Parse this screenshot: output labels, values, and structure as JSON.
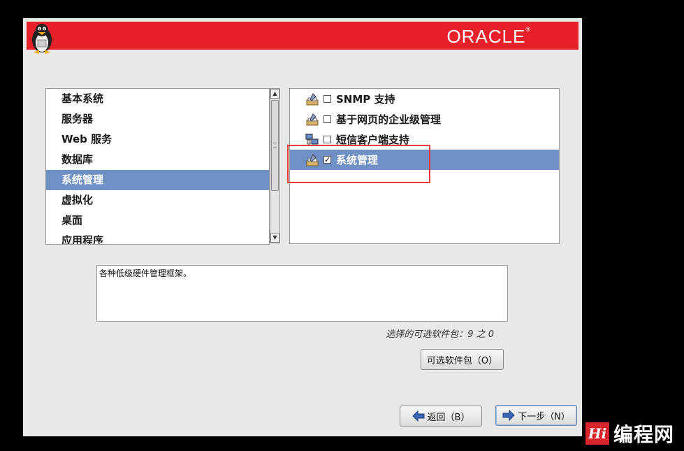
{
  "header": {
    "brand": "ORACLE",
    "brand_mark": "®"
  },
  "categories": {
    "items": [
      {
        "label": "基本系统",
        "selected": false
      },
      {
        "label": "服务器",
        "selected": false
      },
      {
        "label": "Web 服务",
        "selected": false
      },
      {
        "label": "数据库",
        "selected": false
      },
      {
        "label": "系统管理",
        "selected": true
      },
      {
        "label": "虚拟化",
        "selected": false
      },
      {
        "label": "桌面",
        "selected": false
      },
      {
        "label": "应用程序",
        "selected": false
      }
    ]
  },
  "packages": {
    "items": [
      {
        "label": "SNMP 支持",
        "checked": false,
        "checkmark": "",
        "icon": "tools-icon"
      },
      {
        "label": "基于网页的企业级管理",
        "checked": false,
        "checkmark": "",
        "icon": "tools-icon"
      },
      {
        "label": "短信客户端支持",
        "checked": false,
        "checkmark": "",
        "icon": "network-computers-icon"
      },
      {
        "label": "系统管理",
        "checked": true,
        "checkmark": "✓",
        "icon": "tools-icon"
      }
    ]
  },
  "description": "各种低级硬件管理框架。",
  "optional_count": "选择的可选软件包：9 之 0",
  "buttons": {
    "optional": "可选软件包（O）",
    "back": "返回（B）",
    "next": "下一步（N）"
  },
  "watermark": {
    "mark": "Hi",
    "text": "编程网"
  },
  "colors": {
    "header": "#e7202a",
    "selection": "#6f90c4",
    "highlight_box": "#e83a3a"
  }
}
